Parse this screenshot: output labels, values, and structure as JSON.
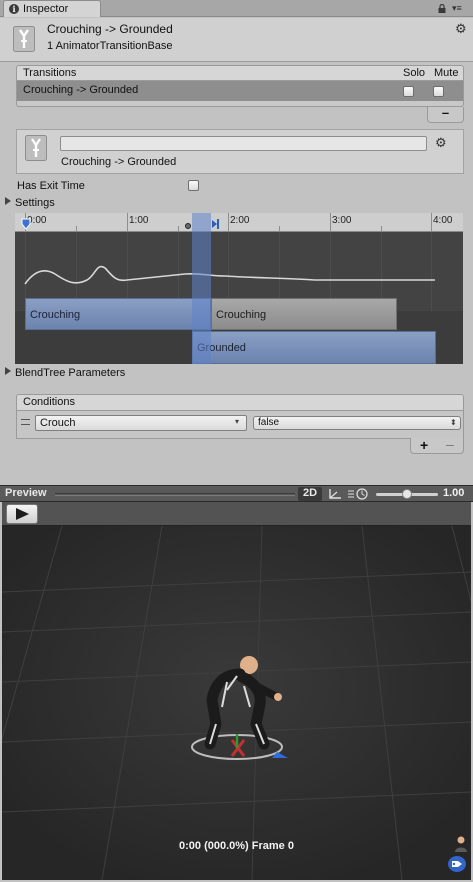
{
  "tab": {
    "label": "Inspector",
    "info_icon": "info-icon",
    "lock_icon": "lock-icon",
    "menu_icon": "tab-menu-icon"
  },
  "header": {
    "title": "Crouching -> Grounded",
    "subtitle": "1 AnimatorTransitionBase",
    "icon": "transition-icon",
    "gear_icon": "gear-icon"
  },
  "transitions": {
    "title": "Transitions",
    "solo_label": "Solo",
    "mute_label": "Mute",
    "rows": [
      {
        "label": "Crouching -> Grounded",
        "solo": false,
        "mute": false
      }
    ],
    "remove_label": "–"
  },
  "detail": {
    "name_value": "",
    "title": "Crouching -> Grounded",
    "icon": "transition-icon",
    "gear_icon": "gear-icon"
  },
  "has_exit_time": {
    "label": "Has Exit Time",
    "checked": false
  },
  "settings": {
    "label": "Settings",
    "expanded": false
  },
  "timeline": {
    "ticks": [
      "0:00",
      "1:00",
      "2:00",
      "3:00",
      "4:00"
    ],
    "clip_source_top": "Crouching",
    "clip_source_bottom": "Crouching",
    "clip_target": "Grounded",
    "colors": {
      "source": "#7b90ba",
      "target": "#7b90ba",
      "inactive": "#9a9a9a",
      "overlap": "#5f82c8"
    }
  },
  "blend_tree": {
    "label": "BlendTree Parameters",
    "expanded": false
  },
  "conditions": {
    "title": "Conditions",
    "rows": [
      {
        "parameter": "Crouch",
        "value": "false"
      }
    ],
    "add_label": "+",
    "remove_label": "–"
  },
  "preview": {
    "label": "Preview",
    "mode_2d": "2D",
    "speed_value": "1.00",
    "speed_fraction": 0.5,
    "frame_readout": "0:00 (000.0%) Frame 0",
    "play_icon": "play-icon",
    "pivot_icon": "pivot-icon",
    "speed_icon": "playback-speed-icon",
    "avatar_icon": "avatar-icon",
    "tag_icon": "tag-icon"
  }
}
